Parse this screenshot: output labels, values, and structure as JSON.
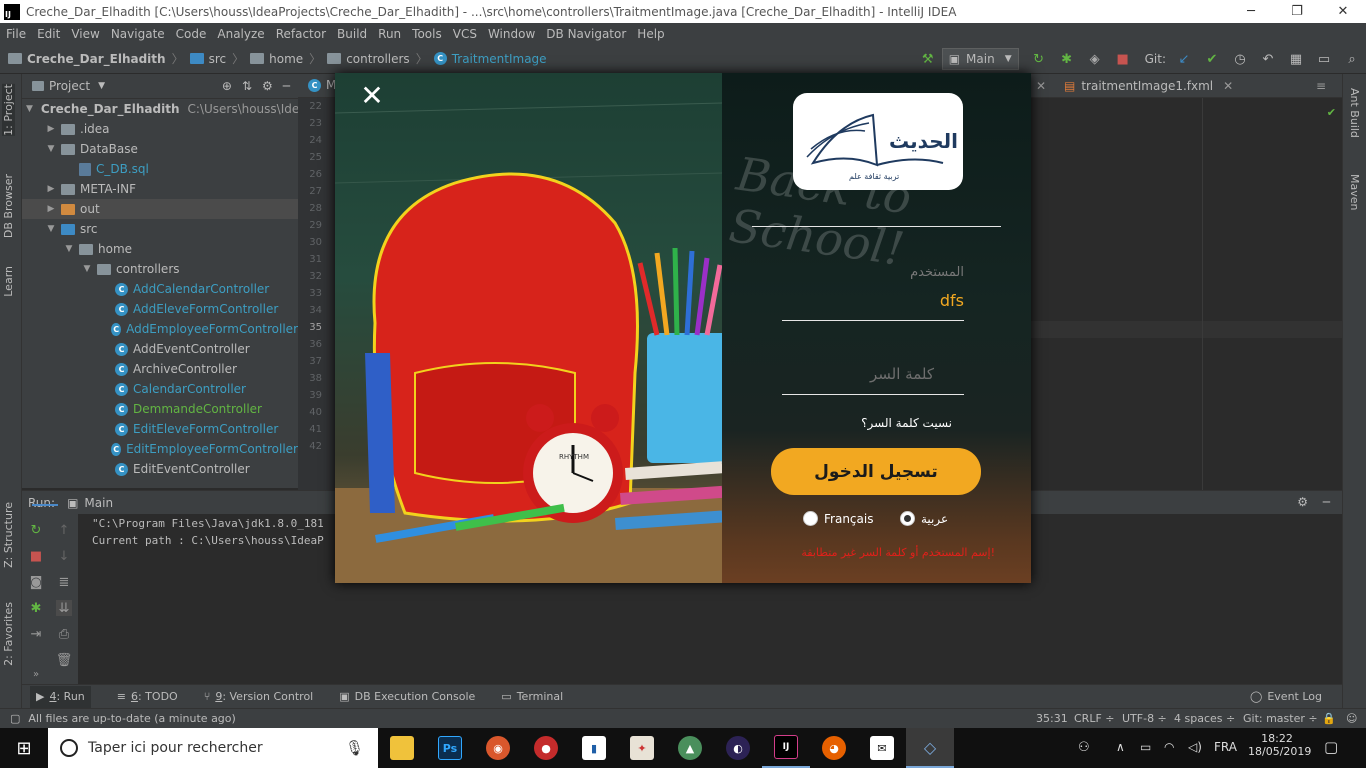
{
  "window": {
    "title": "Creche_Dar_Elhadith [C:\\Users\\houss\\IdeaProjects\\Creche_Dar_Elhadith] - ...\\src\\home\\controllers\\TraitmentImage.java [Creche_Dar_Elhadith] - IntelliJ IDEA",
    "app_icon": "IJ"
  },
  "menu": [
    "File",
    "Edit",
    "View",
    "Navigate",
    "Code",
    "Analyze",
    "Refactor",
    "Build",
    "Run",
    "Tools",
    "VCS",
    "Window",
    "DB Navigator",
    "Help"
  ],
  "breadcrumb": [
    "Creche_Dar_Elhadith",
    "src",
    "home",
    "controllers",
    "TraitmentImage"
  ],
  "toolbar": {
    "run_config": "Main",
    "git_label": "Git:"
  },
  "left_stripe": {
    "project": "1: Project",
    "db_browser": "DB Browser",
    "learn": "Learn",
    "structure": "Z: Structure",
    "favorites": "2: Favorites"
  },
  "right_stripe": {
    "ant": "Ant Build",
    "maven": "Maven"
  },
  "project_panel": {
    "title": "Project",
    "tree": [
      {
        "label": "Creche_Dar_Elhadith",
        "extra": "C:\\Users\\houss\\IdeaPr",
        "depth": 0,
        "open": true,
        "kind": "module"
      },
      {
        "label": ".idea",
        "depth": 1,
        "open": false,
        "kind": "folder"
      },
      {
        "label": "DataBase",
        "depth": 1,
        "open": true,
        "kind": "folder"
      },
      {
        "label": "C_DB.sql",
        "depth": 2,
        "kind": "sql"
      },
      {
        "label": "META-INF",
        "depth": 1,
        "open": false,
        "kind": "folder"
      },
      {
        "label": "out",
        "depth": 1,
        "open": false,
        "kind": "folder-out"
      },
      {
        "label": "src",
        "depth": 1,
        "open": true,
        "kind": "folder"
      },
      {
        "label": "home",
        "depth": 2,
        "open": true,
        "kind": "folder"
      },
      {
        "label": "controllers",
        "depth": 3,
        "open": true,
        "kind": "folder"
      },
      {
        "label": "AddCalendarController",
        "depth": 4,
        "kind": "class-blue"
      },
      {
        "label": "AddEleveFormController",
        "depth": 4,
        "kind": "class-blue"
      },
      {
        "label": "AddEmployeeFormController",
        "depth": 4,
        "kind": "class-blue"
      },
      {
        "label": "AddEventController",
        "depth": 4,
        "kind": "class"
      },
      {
        "label": "ArchiveController",
        "depth": 4,
        "kind": "class"
      },
      {
        "label": "CalendarController",
        "depth": 4,
        "kind": "class-blue"
      },
      {
        "label": "DemmandeController",
        "depth": 4,
        "kind": "class-green"
      },
      {
        "label": "EditEleveFormController",
        "depth": 4,
        "kind": "class-blue"
      },
      {
        "label": "EditEmployeeFormController",
        "depth": 4,
        "kind": "class-blue"
      },
      {
        "label": "EditEventController",
        "depth": 4,
        "kind": "class"
      }
    ]
  },
  "gutter_lines": [
    "22",
    "23",
    "24",
    "25",
    "26",
    "27",
    "28",
    "29",
    "30",
    "31",
    "32",
    "33",
    "34",
    "35",
    "36",
    "37",
    "38",
    "39",
    "40",
    "41",
    "42"
  ],
  "editor_tabs": {
    "left": "M",
    "right": "traitmentImage1.fxml"
  },
  "run_panel": {
    "label": "Run:",
    "tab": "Main",
    "console": [
      "\"C:\\Program Files\\Java\\jdk1.8.0_181",
      "Current path : C:\\Users\\houss\\IdeaP"
    ]
  },
  "tool_tabs": [
    {
      "key": "4",
      "label": ": Run",
      "glyph": "▶"
    },
    {
      "key": "6",
      "label": ": TODO",
      "glyph": "≡"
    },
    {
      "key": "9",
      "label": ": Version Control",
      "glyph": "⑂"
    },
    {
      "key": "",
      "label": "DB Execution Console",
      "glyph": "▣"
    },
    {
      "key": "",
      "label": "Terminal",
      "glyph": "▭"
    }
  ],
  "event_log": "Event Log",
  "status": {
    "message": "All files are up-to-date (a minute ago)",
    "position": "35:31",
    "line_sep": "CRLF ÷",
    "encoding": "UTF-8 ÷",
    "indent": "4 spaces ÷",
    "git": "Git: master ÷"
  },
  "taskbar": {
    "search_placeholder": "Taper ici pour rechercher",
    "lang": "FRA",
    "time": "18:22",
    "date": "18/05/2019"
  },
  "login": {
    "logo_title": "الحديث",
    "logo_tagline": "تربية ثقافة علم",
    "username_label": "المستخدم",
    "username_value": "dfs",
    "password_placeholder": "كلمة السر",
    "forgot_link": "نسيت كلمة السر؟",
    "login_button": "تسجيل الدخول",
    "lang_fr": "Français",
    "lang_ar": "عربية",
    "selected_lang": "عربية",
    "error": "إسم المستخدم أو كلمة السر غير متطابقة!",
    "chalk_text": "Back to School!",
    "clock_brand": "RHYTHM"
  },
  "colors": {
    "accent_button": "#f2a821",
    "error": "#e0201a",
    "class_blue": "#3d9ec2",
    "class_green": "#62b543"
  }
}
